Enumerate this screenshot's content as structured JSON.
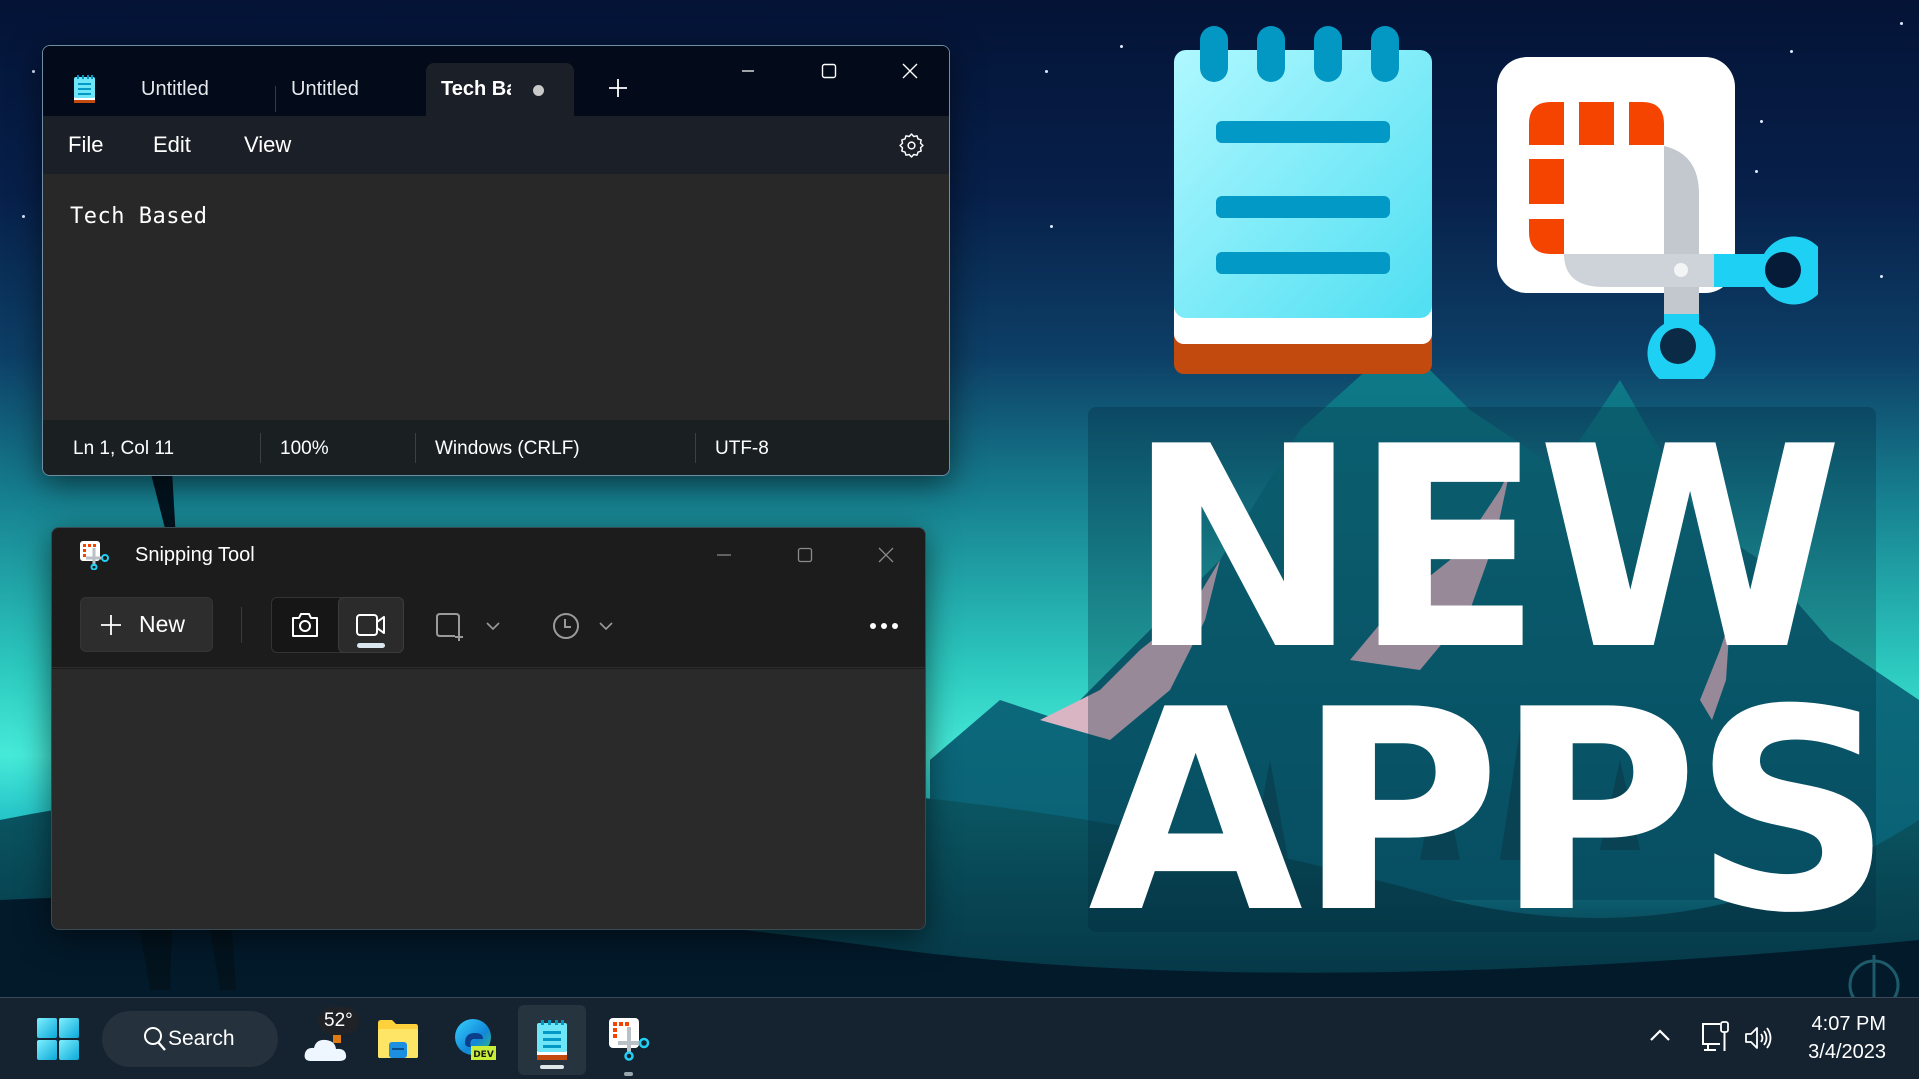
{
  "notepad": {
    "app_icon": "notepad-icon",
    "tabs": [
      {
        "label": "Untitled",
        "active": false
      },
      {
        "label": "Untitled",
        "active": false
      },
      {
        "label": "Tech Based",
        "active": true,
        "unsaved": true
      }
    ],
    "new_tab_icon": "plus-icon",
    "window_controls": [
      "minimize-icon",
      "maximize-icon",
      "close-icon"
    ],
    "menu": [
      {
        "label": "File"
      },
      {
        "label": "Edit"
      },
      {
        "label": "View"
      }
    ],
    "settings_icon": "gear-icon",
    "content": "Tech Based",
    "status": {
      "position": "Ln 1, Col 11",
      "zoom": "100%",
      "line_ending": "Windows (CRLF)",
      "encoding": "UTF-8"
    }
  },
  "snipping_tool": {
    "title": "Snipping Tool",
    "app_icon": "snipping-tool-icon",
    "window_controls": [
      "minimize-icon",
      "maximize-icon",
      "close-icon"
    ],
    "toolbar": {
      "new_label": "New",
      "modes": [
        {
          "name": "screenshot",
          "icon": "camera-icon",
          "selected": false
        },
        {
          "name": "record",
          "icon": "video-camera-icon",
          "selected": true
        }
      ],
      "snip_shape_icon": "rectangle-snip-icon",
      "delay_icon": "clock-icon",
      "more_icon": "more-icon"
    }
  },
  "promo": {
    "line1": "NEW",
    "line2": "APPS"
  },
  "taskbar": {
    "search_label": "Search",
    "weather_temp": "52°",
    "apps": [
      {
        "name": "start",
        "icon": "windows-logo-icon"
      },
      {
        "name": "weather",
        "icon": "cloud-icon"
      },
      {
        "name": "file-explorer",
        "icon": "folder-icon"
      },
      {
        "name": "edge-dev",
        "icon": "edge-dev-icon",
        "badge": "DEV"
      },
      {
        "name": "notepad",
        "icon": "notepad-icon",
        "active": true
      },
      {
        "name": "snipping-tool",
        "icon": "snipping-tool-icon",
        "running": true
      }
    ],
    "tray": {
      "overflow_icon": "chevron-up-icon",
      "network_icon": "ethernet-icon",
      "volume_icon": "speaker-icon",
      "time": "4:07 PM",
      "date": "3/4/2023"
    }
  },
  "colors": {
    "notepad_accent": "#5fe2f5",
    "notepad_lines": "#0399c6",
    "notepad_base": "#c24a0e",
    "snip_red": "#f54300",
    "snip_blue": "#1fd0f5",
    "promo_text": "#ffffff"
  }
}
